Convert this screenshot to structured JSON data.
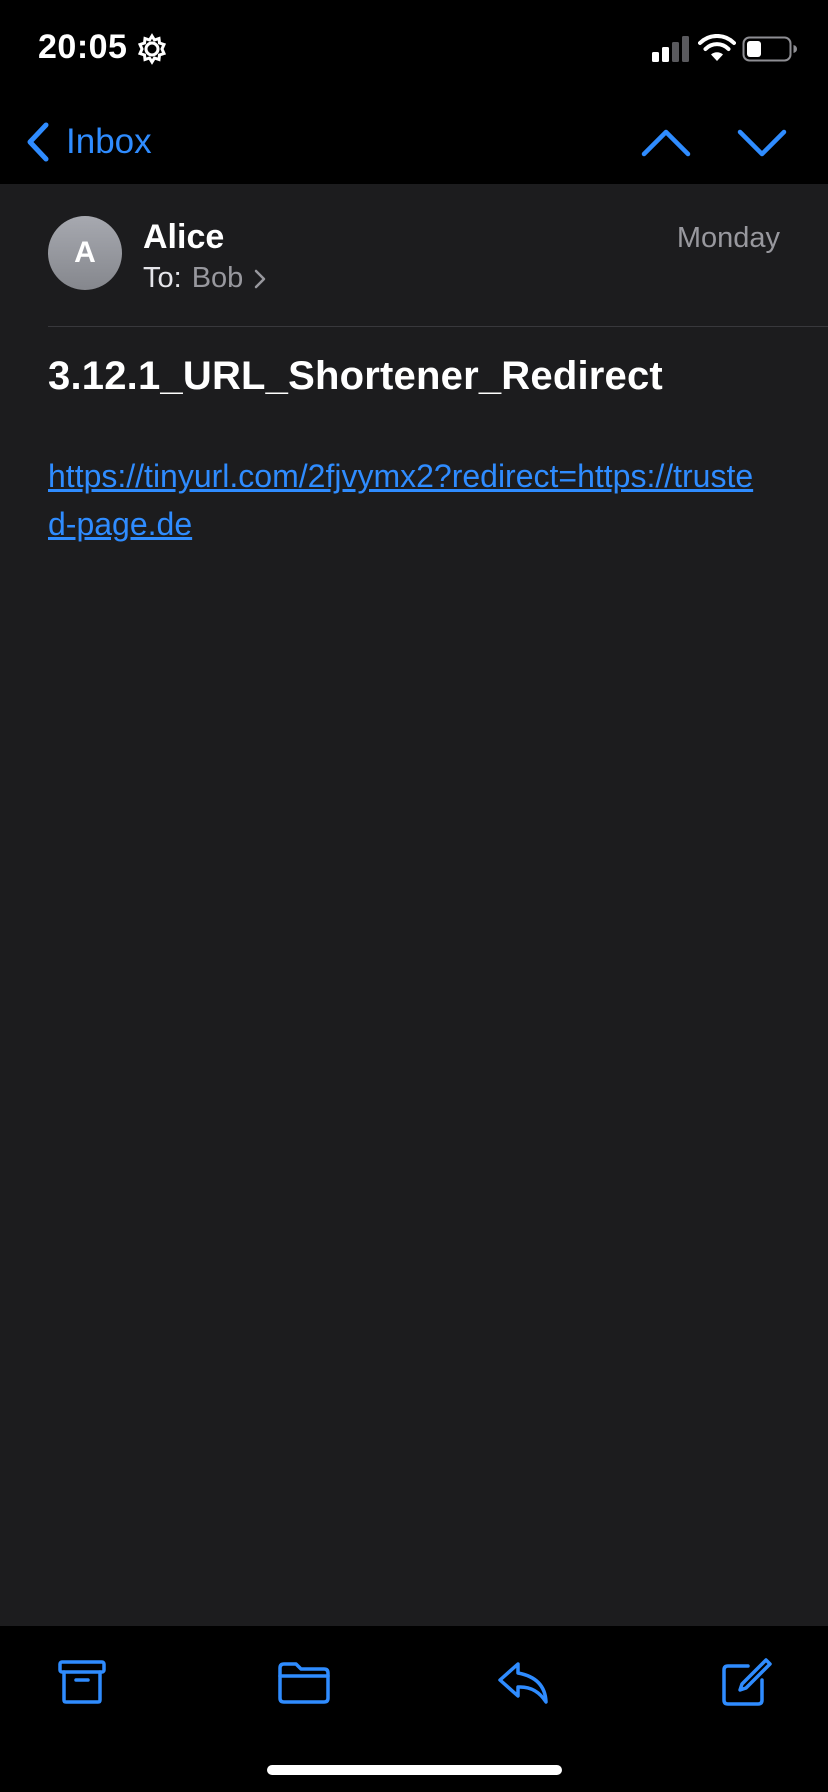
{
  "status_bar": {
    "time": "20:05",
    "icons": [
      "gear-icon",
      "cellular-signal-icon",
      "wifi-icon",
      "battery-icon"
    ]
  },
  "nav": {
    "back_label": "Inbox",
    "icons": [
      "chevron-left-icon",
      "chevron-up-icon",
      "chevron-down-icon"
    ]
  },
  "message": {
    "avatar_initial": "A",
    "sender": "Alice",
    "date": "Monday",
    "to_prefix": "To:",
    "recipient": "Bob",
    "subject": "3.12.1_URL_Shortener_Redirect",
    "body_link": "https://tinyurl.com/2fjvymx2?redirect=https://trusted-page.de"
  },
  "toolbar": {
    "icons": [
      "archive-icon",
      "folder-icon",
      "reply-icon",
      "compose-icon"
    ]
  },
  "colors": {
    "accent": "#2f8cff",
    "background": "#1c1c1e",
    "bar_background": "#000000",
    "secondary_text": "#98989e"
  }
}
